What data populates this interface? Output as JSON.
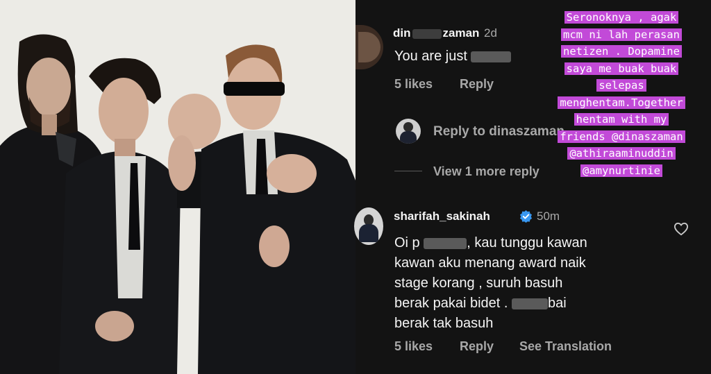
{
  "colors": {
    "panel_bg": "#131313",
    "verified": "#3897f0",
    "sticker_bg": "#c24ad8"
  },
  "comment1": {
    "username": "din",
    "username_tail": "zaman",
    "time": "2d",
    "text_start": "You are just",
    "likes": "5 likes",
    "reply": "Reply"
  },
  "reply_composer": {
    "prompt": "Reply to dinaszaman"
  },
  "view_more": "View 1 more reply",
  "sticker_lines": [
    "Seronoknya , agak",
    "mcm ni lah  perasan",
    "netizen . Dopamine",
    "saya me buak buak",
    "selepas",
    "menghentam.Together",
    "hentam with my",
    "friends @dinaszaman",
    "@athiraaminuddin",
    "@amynurtinie"
  ],
  "comment2": {
    "username": "sharifah_sakinah",
    "time": "50m",
    "line1_a": "Oi p",
    "line1_b": ", kau tunggu kawan",
    "line2": "kawan aku menang award naik",
    "line3": "stage  korang , suruh basuh",
    "line4_a": "berak pakai bidet .",
    "line4_b": "bai",
    "line5": "berak tak basuh",
    "likes": "5 likes",
    "reply": "Reply",
    "translate": "See Translation"
  },
  "icons": [
    "verified-badge-icon",
    "heart-icon"
  ]
}
